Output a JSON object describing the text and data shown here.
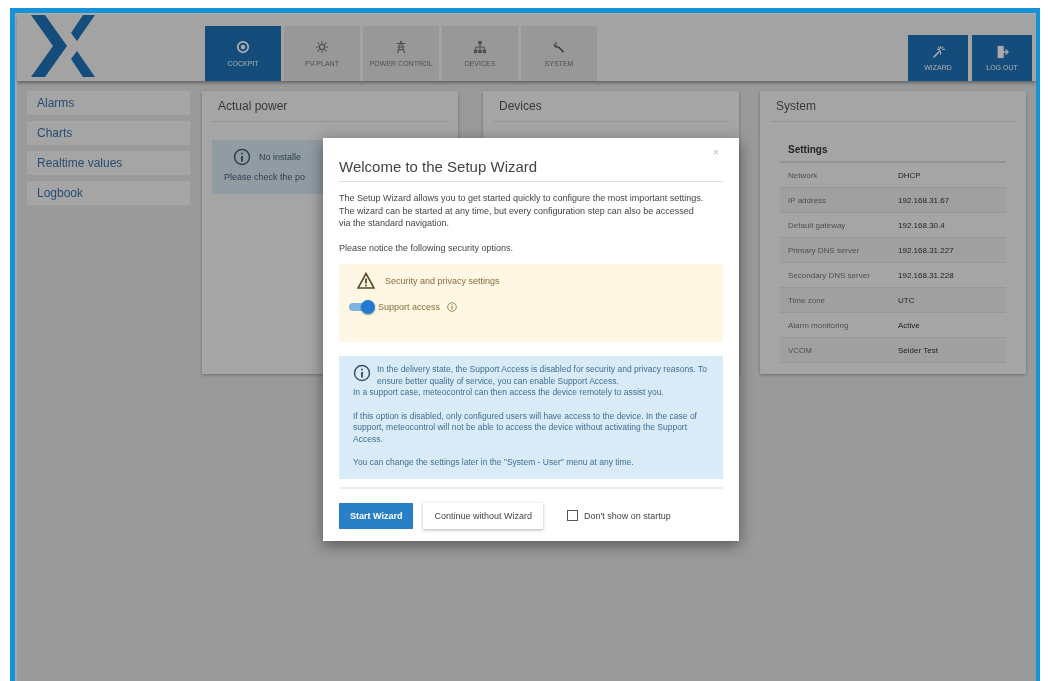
{
  "header": {
    "tabs": [
      {
        "label": "COCKPIT",
        "selected": true
      },
      {
        "label": "PV-PLANT",
        "selected": false
      },
      {
        "label": "POWER CONTROL",
        "selected": false
      },
      {
        "label": "DEVICES",
        "selected": false
      },
      {
        "label": "SYSTEM",
        "selected": false
      }
    ],
    "actions": [
      {
        "label": "WIZARD"
      },
      {
        "label": "LOG OUT"
      }
    ]
  },
  "sidebar": {
    "items": [
      "Alarms",
      "Charts",
      "Realtime values",
      "Logbook"
    ]
  },
  "cards": [
    {
      "title": "Actual power",
      "notice": {
        "title": "No installe",
        "text": "Please check the po"
      }
    },
    {
      "title": "Devices"
    },
    {
      "title": "System",
      "settings": {
        "title": "Settings",
        "rows": [
          {
            "label": "Network",
            "value": "DHCP"
          },
          {
            "label": "IP address",
            "value": "192.168.31.67"
          },
          {
            "label": "Default gateway",
            "value": "192.168.30.4"
          },
          {
            "label": "Primary DNS server",
            "value": "192.168.31.227"
          },
          {
            "label": "Secondary DNS server",
            "value": "192.168.31.228"
          },
          {
            "label": "Time zone",
            "value": "UTC"
          },
          {
            "label": "Alarm monitoring",
            "value": "Active"
          },
          {
            "label": "VCOM",
            "value": "Seider Test"
          }
        ]
      }
    }
  ],
  "dialog": {
    "title": "Welcome to the Setup Wizard",
    "close": "×",
    "intro": [
      "The Setup Wizard allows you to get started quickly to configure the most important settings.",
      "The wizard can be started at any time, but every configuration step can also be accessed via the standard navigation."
    ],
    "notice": "Please notice the following security options.",
    "warning": {
      "title": "Security and privacy settings",
      "toggle": {
        "label": "Support access",
        "on": true
      }
    },
    "info": [
      "In the delivery state, the Support Access is disabled for security and privacy reasons. To ensure better quality of service, you can enable Support Access.",
      "In a support case, meteocontrol can then access the device remotely to assist you.",
      "If this option is disabled, only configured users will have access to the device. In the case of support, meteocontrol will not be able to access the device without activating the Support Access.",
      "You can change the settings later in the \"System - User\" menu at any time."
    ],
    "primary": "Start Wizard",
    "secondary": "Continue without Wizard",
    "checkbox": {
      "label": "Don't show on startup",
      "checked": false
    }
  }
}
